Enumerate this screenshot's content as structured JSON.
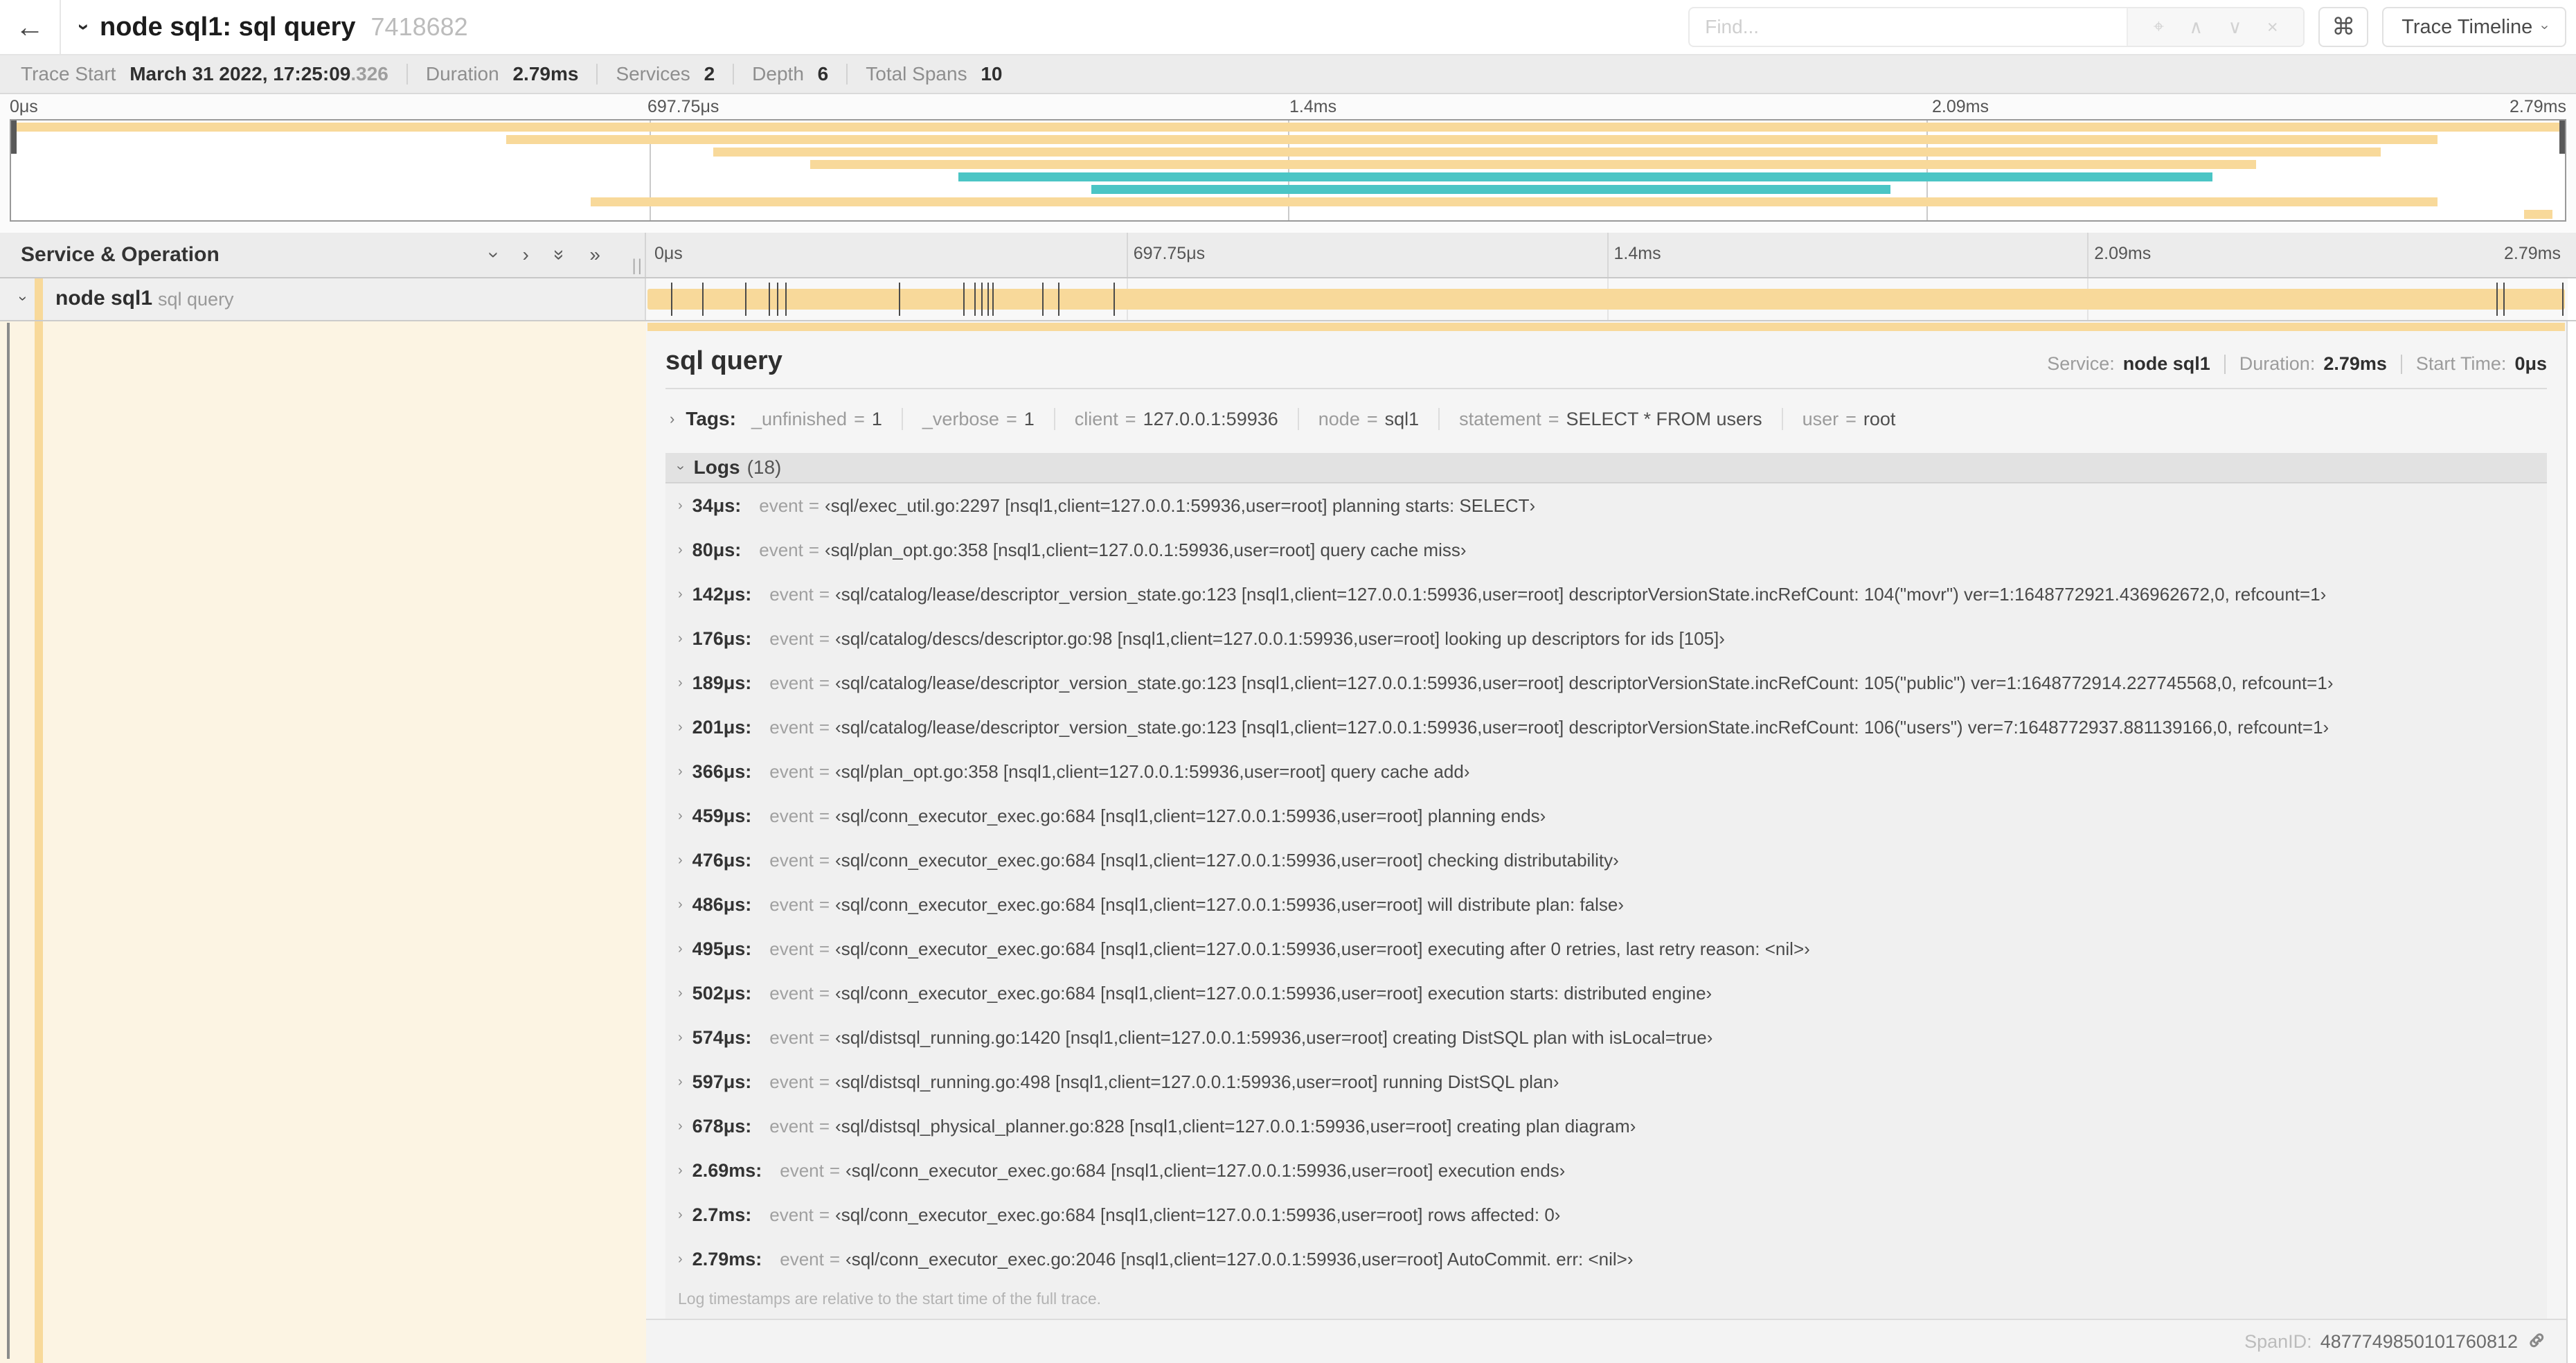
{
  "colors": {
    "span_orange": "#F8D99A",
    "span_teal": "#4BC5C5",
    "detail_left_bg": "#FCF4E3"
  },
  "topnav": {
    "back_icon": "←",
    "title": "node sql1: sql query",
    "trace_id": "7418682",
    "find_placeholder": "Find...",
    "shortcut_key": "⌘",
    "view_button": "Trace Timeline"
  },
  "summary": {
    "items": [
      {
        "label": "Trace Start",
        "value": "March 31 2022, 17:25:09",
        "suffix": ".326"
      },
      {
        "label": "Duration",
        "value": "2.79ms"
      },
      {
        "label": "Services",
        "value": "2"
      },
      {
        "label": "Depth",
        "value": "6"
      },
      {
        "label": "Total Spans",
        "value": "10"
      }
    ]
  },
  "timeline": {
    "ticks": [
      "0μs",
      "697.75μs",
      "1.4ms",
      "2.09ms",
      "2.79ms"
    ],
    "minimap_spans": [
      {
        "start": 0.0,
        "end": 1.0,
        "color": "#F8D99A"
      },
      {
        "start": 0.194,
        "end": 0.95,
        "color": "#F8D99A"
      },
      {
        "start": 0.275,
        "end": 0.928,
        "color": "#F8D99A"
      },
      {
        "start": 0.313,
        "end": 0.879,
        "color": "#F8D99A"
      },
      {
        "start": 0.371,
        "end": 0.862,
        "color": "#4BC5C5"
      },
      {
        "start": 0.423,
        "end": 0.736,
        "color": "#4BC5C5"
      },
      {
        "start": 0.227,
        "end": 0.95,
        "color": "#F8D99A"
      },
      {
        "start": 0.984,
        "end": 0.995,
        "color": "#F8D99A"
      }
    ],
    "marker_fracs": [
      0.0122,
      0.0287,
      0.0509,
      0.0631,
      0.0677,
      0.072,
      0.1312,
      0.1645,
      0.1706,
      0.1742,
      0.1774,
      0.18,
      0.2057,
      0.214,
      0.243,
      0.9641,
      0.9677,
      0.9985
    ]
  },
  "tree": {
    "header": "Service & Operation",
    "row": {
      "service": "node sql1",
      "operation": "sql query"
    }
  },
  "detail": {
    "title": "sql query",
    "meta": [
      {
        "label": "Service:",
        "value": "node sql1"
      },
      {
        "label": "Duration:",
        "value": "2.79ms"
      },
      {
        "label": "Start Time:",
        "value": "0μs"
      }
    ],
    "tags_label": "Tags:",
    "tags": [
      {
        "key": "_unfinished",
        "value": "1"
      },
      {
        "key": "_verbose",
        "value": "1"
      },
      {
        "key": "client",
        "value": "127.0.0.1:59936"
      },
      {
        "key": "node",
        "value": "sql1"
      },
      {
        "key": "statement",
        "value": "SELECT * FROM users"
      },
      {
        "key": "user",
        "value": "root"
      }
    ],
    "logs_label": "Logs",
    "logs_count": "(18)",
    "logs": [
      {
        "time": "34μs:",
        "key": "event",
        "value": "‹sql/exec_util.go:2297 [nsql1,client=127.0.0.1:59936,user=root] planning starts: SELECT›"
      },
      {
        "time": "80μs:",
        "key": "event",
        "value": "‹sql/plan_opt.go:358 [nsql1,client=127.0.0.1:59936,user=root] query cache miss›"
      },
      {
        "time": "142μs:",
        "key": "event",
        "value": "‹sql/catalog/lease/descriptor_version_state.go:123 [nsql1,client=127.0.0.1:59936,user=root] descriptorVersionState.incRefCount: 104(\"movr\") ver=1:1648772921.436962672,0, refcount=1›"
      },
      {
        "time": "176μs:",
        "key": "event",
        "value": "‹sql/catalog/descs/descriptor.go:98 [nsql1,client=127.0.0.1:59936,user=root] looking up descriptors for ids [105]›"
      },
      {
        "time": "189μs:",
        "key": "event",
        "value": "‹sql/catalog/lease/descriptor_version_state.go:123 [nsql1,client=127.0.0.1:59936,user=root] descriptorVersionState.incRefCount: 105(\"public\") ver=1:1648772914.227745568,0, refcount=1›"
      },
      {
        "time": "201μs:",
        "key": "event",
        "value": "‹sql/catalog/lease/descriptor_version_state.go:123 [nsql1,client=127.0.0.1:59936,user=root] descriptorVersionState.incRefCount: 106(\"users\") ver=7:1648772937.881139166,0, refcount=1›"
      },
      {
        "time": "366μs:",
        "key": "event",
        "value": "‹sql/plan_opt.go:358 [nsql1,client=127.0.0.1:59936,user=root] query cache add›"
      },
      {
        "time": "459μs:",
        "key": "event",
        "value": "‹sql/conn_executor_exec.go:684 [nsql1,client=127.0.0.1:59936,user=root] planning ends›"
      },
      {
        "time": "476μs:",
        "key": "event",
        "value": "‹sql/conn_executor_exec.go:684 [nsql1,client=127.0.0.1:59936,user=root] checking distributability›"
      },
      {
        "time": "486μs:",
        "key": "event",
        "value": "‹sql/conn_executor_exec.go:684 [nsql1,client=127.0.0.1:59936,user=root] will distribute plan: false›"
      },
      {
        "time": "495μs:",
        "key": "event",
        "value": "‹sql/conn_executor_exec.go:684 [nsql1,client=127.0.0.1:59936,user=root] executing after 0 retries, last retry reason: <nil>›"
      },
      {
        "time": "502μs:",
        "key": "event",
        "value": "‹sql/conn_executor_exec.go:684 [nsql1,client=127.0.0.1:59936,user=root] execution starts: distributed engine›"
      },
      {
        "time": "574μs:",
        "key": "event",
        "value": "‹sql/distsql_running.go:1420 [nsql1,client=127.0.0.1:59936,user=root] creating DistSQL plan with isLocal=true›"
      },
      {
        "time": "597μs:",
        "key": "event",
        "value": "‹sql/distsql_running.go:498 [nsql1,client=127.0.0.1:59936,user=root] running DistSQL plan›"
      },
      {
        "time": "678μs:",
        "key": "event",
        "value": "‹sql/distsql_physical_planner.go:828 [nsql1,client=127.0.0.1:59936,user=root] creating plan diagram›"
      },
      {
        "time": "2.69ms:",
        "key": "event",
        "value": "‹sql/conn_executor_exec.go:684 [nsql1,client=127.0.0.1:59936,user=root] execution ends›"
      },
      {
        "time": "2.7ms:",
        "key": "event",
        "value": "‹sql/conn_executor_exec.go:684 [nsql1,client=127.0.0.1:59936,user=root] rows affected: 0›"
      },
      {
        "time": "2.79ms:",
        "key": "event",
        "value": "‹sql/conn_executor_exec.go:2046 [nsql1,client=127.0.0.1:59936,user=root] AutoCommit. err: <nil>›"
      }
    ],
    "logs_footer": "Log timestamps are relative to the start time of the full trace.",
    "spanid_label": "SpanID:",
    "spanid_value": "4877749850101760812"
  }
}
